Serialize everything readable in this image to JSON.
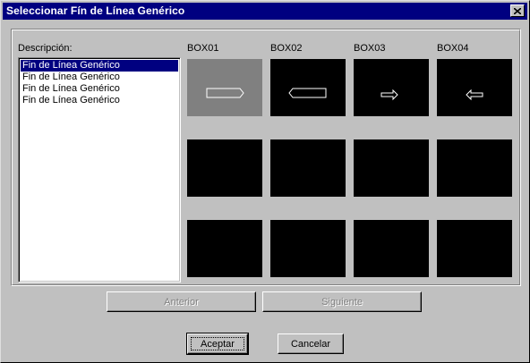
{
  "window": {
    "title": "Seleccionar Fín de Línea Genérico",
    "close_glyph": "✕"
  },
  "description": {
    "label": "Descripción:",
    "items": [
      {
        "label": "Fin de Línea Genérico",
        "selected": true
      },
      {
        "label": "Fin de Línea Genérico",
        "selected": false
      },
      {
        "label": "Fin de Línea Genérico",
        "selected": false
      },
      {
        "label": "Fin de Línea Genérico",
        "selected": false
      }
    ]
  },
  "boxes": {
    "labels": [
      "BOX01",
      "BOX02",
      "BOX03",
      "BOX04"
    ],
    "tiles": [
      {
        "icon": "pointed-end-right-icon",
        "selected": true
      },
      {
        "icon": "pointed-end-left-icon",
        "selected": false
      },
      {
        "icon": "arrow-right-icon",
        "selected": false
      },
      {
        "icon": "arrow-left-icon",
        "selected": false
      },
      {
        "icon": "",
        "selected": false
      },
      {
        "icon": "",
        "selected": false
      },
      {
        "icon": "",
        "selected": false
      },
      {
        "icon": "",
        "selected": false
      },
      {
        "icon": "",
        "selected": false
      },
      {
        "icon": "",
        "selected": false
      },
      {
        "icon": "",
        "selected": false
      },
      {
        "icon": "",
        "selected": false
      }
    ]
  },
  "nav": {
    "previous_label": "Anterior",
    "next_label": "Siguiente"
  },
  "actions": {
    "accept_label": "Aceptar",
    "cancel_label": "Cancelar"
  },
  "colors": {
    "titlebar": "#000080",
    "face": "#c0c0c0",
    "selection": "#000080",
    "tile_bg": "#000000",
    "tile_selected": "#808080"
  }
}
